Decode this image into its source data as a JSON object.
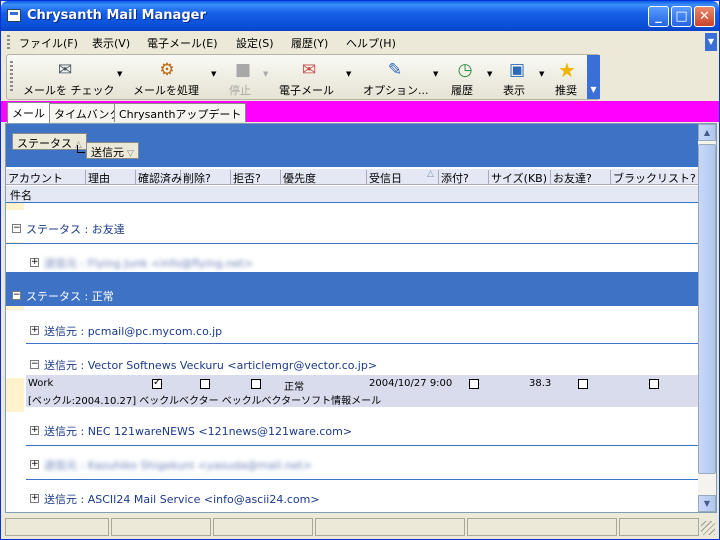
{
  "window": {
    "title": "Chrysanth Mail Manager"
  },
  "menu": [
    "ファイル(F)",
    "表示(V)",
    "電子メール(E)",
    "設定(S)",
    "履歴(Y)",
    "ヘルプ(H)"
  ],
  "toolbar": {
    "check_mail": "メールを チェック",
    "process_mail": "メールを処理",
    "stop": "停止",
    "email": "電子メール",
    "options": "オプション...",
    "history": "履歴",
    "view": "表示",
    "recommend": "推奨"
  },
  "tabs": [
    "メール",
    "タイムバンク",
    "Chrysanthアップデート"
  ],
  "group_by": {
    "first": "ステータス",
    "second": "送信元"
  },
  "columns": [
    "アカウント",
    "理由",
    "確認済み",
    "削除?",
    "拒否?",
    "優先度",
    "受信日",
    "添付?",
    "サイズ(KB)",
    "お友達?",
    "ブラックリスト?"
  ],
  "columns2": [
    "件名"
  ],
  "groups": {
    "friends": "ステータス : お友達",
    "friends_sender": "送信元 : Flying Junk <info@flying.net>",
    "normal": "ステータス : 正常",
    "senders": [
      "送信元 : pcmail@pc.mycom.co.jp",
      "送信元 : Vector Softnews Veckuru <articlemgr@vector.co.jp>",
      "送信元 : NEC 121wareNEWS <121news@121ware.com>",
      "送信元 : Kazuhiko Shigekuni <yasuda@mail.net>",
      "送信元 : ASCII24 Mail Service <info@ascii24.com>"
    ]
  },
  "mail_row": {
    "account": "Work",
    "confirmed": true,
    "delete": false,
    "reject": false,
    "priority": "正常",
    "received": "2004/10/27 9:00",
    "attachment": false,
    "size": "38.3",
    "friend": false,
    "blacklist": false,
    "subject": "[ベックル:2004.10.27] ベックルベクター ベックルベクターソフト情報メール"
  },
  "colors": {
    "accent": "#3d72c4",
    "tab_strip": "#ff00ff",
    "gutter": "#fff2cc"
  }
}
